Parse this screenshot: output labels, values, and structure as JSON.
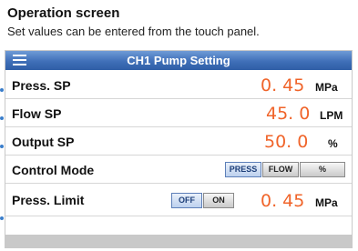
{
  "caption": {
    "title": "Operation screen",
    "subtitle": "Set values can be entered from the touch panel."
  },
  "header": {
    "title": "CH1 Pump Setting",
    "menu_icon": "hamburger-menu-icon"
  },
  "rows": [
    {
      "label": "Press. SP",
      "value": "0. 45",
      "unit": "MPa"
    },
    {
      "label": "Flow SP",
      "value": "45. 0",
      "unit": "LPM"
    },
    {
      "label": "Output SP",
      "value": "50. 0",
      "unit": "%"
    },
    {
      "label": "Control Mode",
      "options": [
        "PRESS",
        "FLOW",
        "%"
      ],
      "selected": "PRESS"
    },
    {
      "label": "Press. Limit",
      "toggle": [
        "OFF",
        "ON"
      ],
      "toggle_selected": "OFF",
      "value": "0. 45",
      "unit": "MPa"
    }
  ],
  "colors": {
    "header": "#3f6fb8",
    "value": "#f0642a",
    "bullet": "#3a7ecb"
  }
}
